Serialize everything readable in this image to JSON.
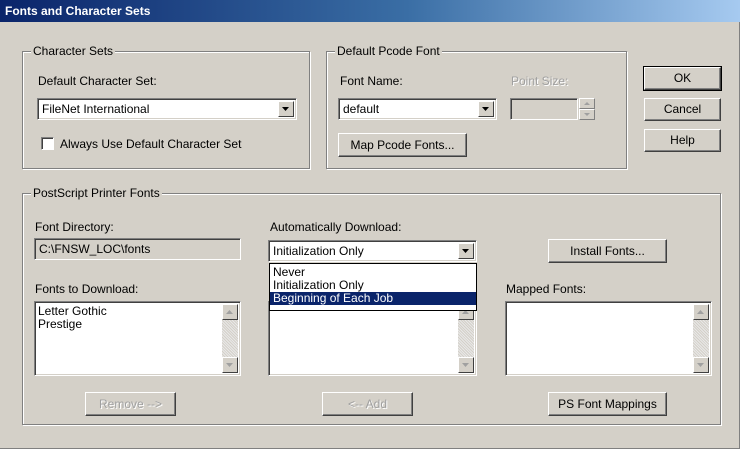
{
  "window": {
    "title": "Fonts and Character Sets"
  },
  "charsets": {
    "group_label": "Character Sets",
    "default_label": "Default Character Set:",
    "default_value": "FileNet International",
    "always_use_label": "Always Use Default Character Set",
    "always_use_checked": false
  },
  "pcode": {
    "group_label": "Default Pcode Font",
    "font_name_label": "Font Name:",
    "font_name_value": "default",
    "point_size_label": "Point Size:",
    "point_size_value": "",
    "map_button": "Map Pcode Fonts..."
  },
  "buttons": {
    "ok": "OK",
    "cancel": "Cancel",
    "help": "Help"
  },
  "postscript": {
    "group_label": "PostScript Printer Fonts",
    "font_directory_label": "Font Directory:",
    "font_directory_value": "C:\\FNSW_LOC\\fonts",
    "auto_download_label": "Automatically Download:",
    "auto_download_value": "Initialization Only",
    "auto_download_options": [
      "Never",
      "Initialization Only",
      "Beginning of Each Job"
    ],
    "auto_download_highlighted": "Beginning of Each Job",
    "install_fonts_button": "Install Fonts...",
    "fonts_to_download_label": "Fonts to Download:",
    "fonts_to_download": [
      "Letter Gothic",
      "Prestige"
    ],
    "mapped_fonts_label": "Mapped Fonts:",
    "mapped_fonts": [],
    "remove_button": "Remove -->",
    "add_button": "<-- Add",
    "ps_mappings_button": "PS Font Mappings"
  },
  "icons": {
    "dropdown": "chevron-down-icon",
    "scroll_up": "arrow-up-icon",
    "scroll_down": "arrow-down-icon",
    "spin_up": "arrow-up-icon",
    "spin_down": "arrow-down-icon"
  }
}
